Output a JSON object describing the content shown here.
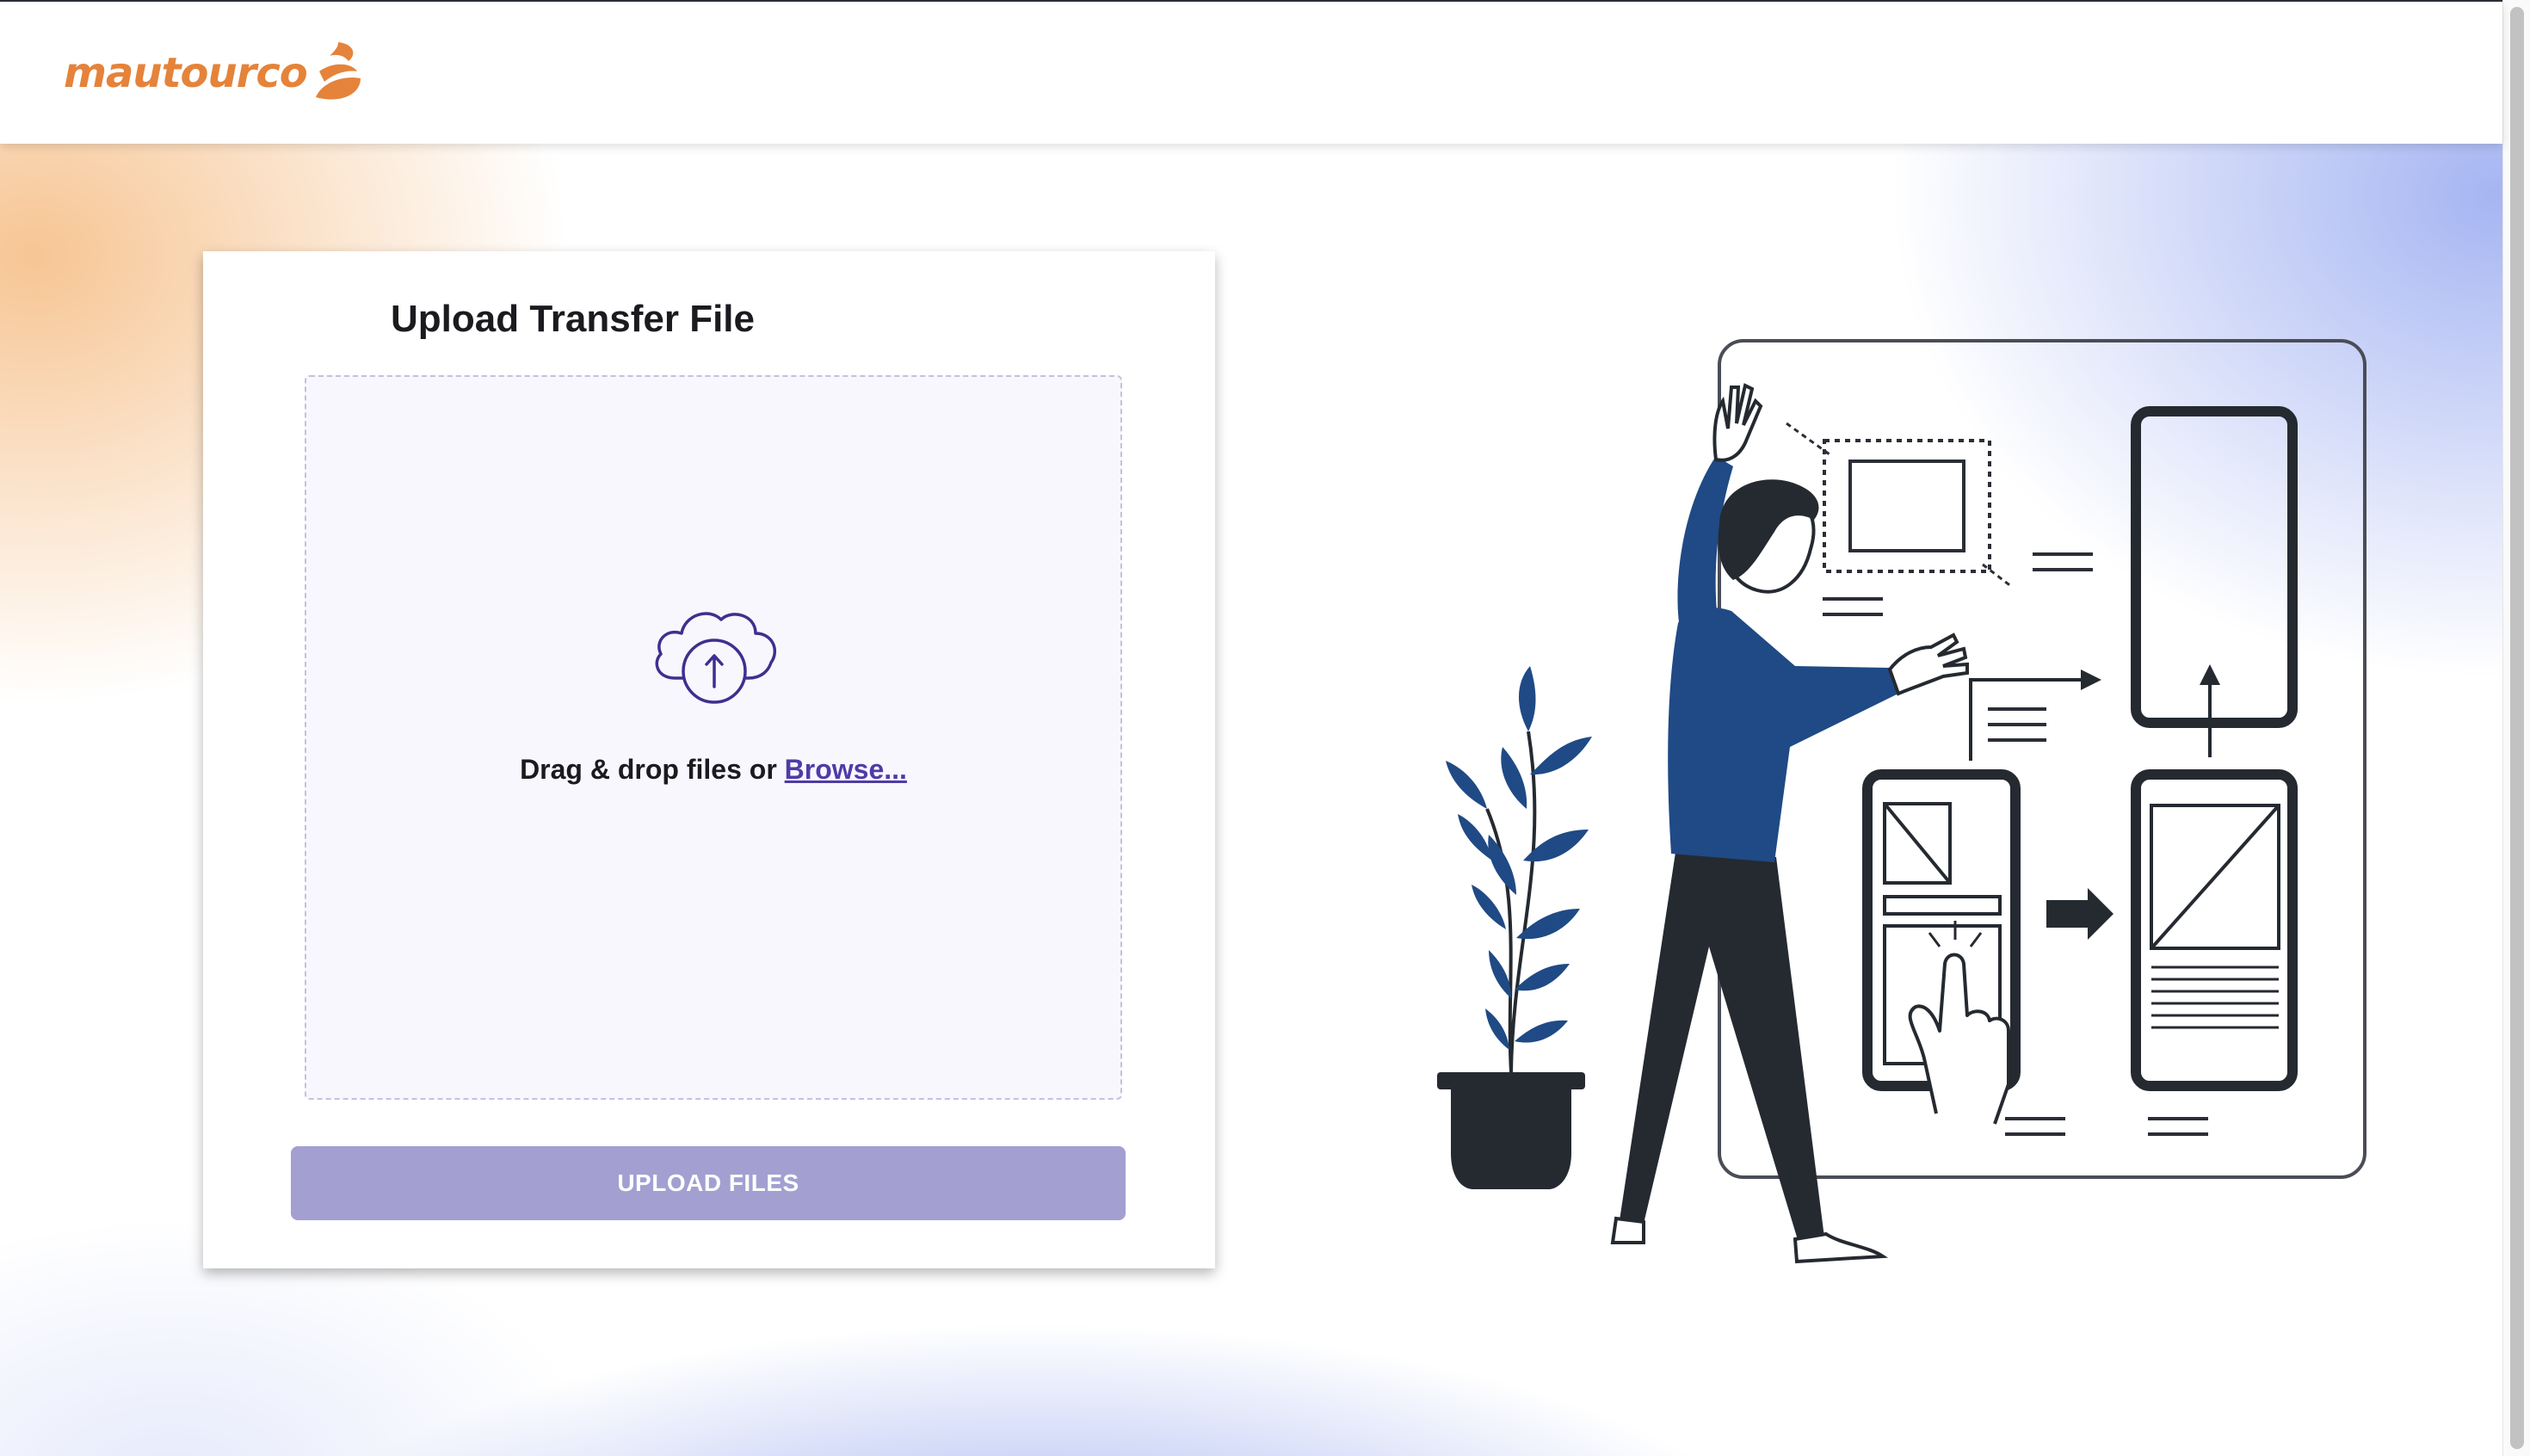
{
  "header": {
    "logo_text": "mautourco",
    "logo_icon": "flame-wave-icon",
    "brand_color": "#e5833a"
  },
  "upload": {
    "title": "Upload Transfer File",
    "dropzone_icon": "cloud-upload-icon",
    "drop_text": "Drag & drop files or ",
    "browse_label": "Browse...",
    "button_label": "UPLOAD FILES",
    "button_color": "#a39fd1",
    "accent_color": "#4f3ba8"
  },
  "illustration": {
    "icon": "ui-design-person-illustration"
  }
}
